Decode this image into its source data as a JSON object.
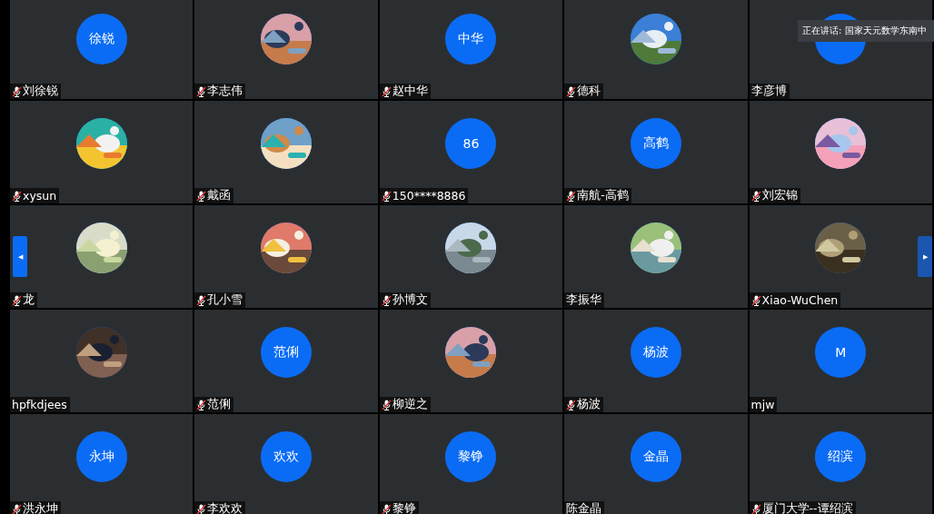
{
  "participants": [
    {
      "name": "刘徐锐",
      "muted": true,
      "avatar": {
        "kind": "initials",
        "text": "徐锐"
      }
    },
    {
      "name": "李志伟",
      "muted": true
    },
    {
      "name": "赵中华",
      "muted": true,
      "avatar": {
        "kind": "initials",
        "text": "中华"
      }
    },
    {
      "name": "德科",
      "muted": true
    },
    {
      "name": "李彦博",
      "muted": false,
      "avatar": {
        "kind": "initials"
      }
    },
    {
      "name": "xysun",
      "muted": true
    },
    {
      "name": "戴函",
      "muted": true
    },
    {
      "name": "150****8886",
      "muted": true,
      "avatar": {
        "kind": "initials",
        "text": "86"
      }
    },
    {
      "name": "南航-高鹤",
      "muted": true,
      "avatar": {
        "kind": "initials",
        "text": "高鹤"
      }
    },
    {
      "name": "刘宏锦",
      "muted": true
    },
    {
      "name": "龙",
      "muted": true
    },
    {
      "name": "孔小雪",
      "muted": true
    },
    {
      "name": "孙博文",
      "muted": true
    },
    {
      "name": "李振华",
      "muted": false
    },
    {
      "name": "Xiao-WuChen",
      "muted": true
    },
    {
      "name": "hpfkdjees",
      "muted": false
    },
    {
      "name": "范俐",
      "muted": true,
      "avatar": {
        "kind": "initials",
        "text": "范俐"
      }
    },
    {
      "name": "柳逆之",
      "muted": true
    },
    {
      "name": "杨波",
      "muted": true,
      "avatar": {
        "kind": "initials",
        "text": "杨波"
      }
    },
    {
      "name": "mjw",
      "muted": false,
      "avatar": {
        "kind": "initials",
        "text": "M"
      }
    },
    {
      "name": "洪永坤",
      "muted": true,
      "avatar": {
        "kind": "initials",
        "text": "永坤"
      }
    },
    {
      "name": "李欢欢",
      "muted": true,
      "avatar": {
        "kind": "initials",
        "text": "欢欢"
      }
    },
    {
      "name": "黎铮",
      "muted": true,
      "avatar": {
        "kind": "initials",
        "text": "黎铮"
      }
    },
    {
      "name": "陈金晶",
      "muted": false,
      "avatar": {
        "kind": "initials",
        "text": "金晶"
      }
    },
    {
      "name": "厦门大学--谭绍滨",
      "muted": true,
      "avatar": {
        "kind": "initials",
        "text": "绍滨"
      }
    }
  ],
  "speaking_tooltip": "正在讲话: 国家天元数学东南中",
  "pager": {
    "previous": "◀",
    "next": "▶"
  }
}
